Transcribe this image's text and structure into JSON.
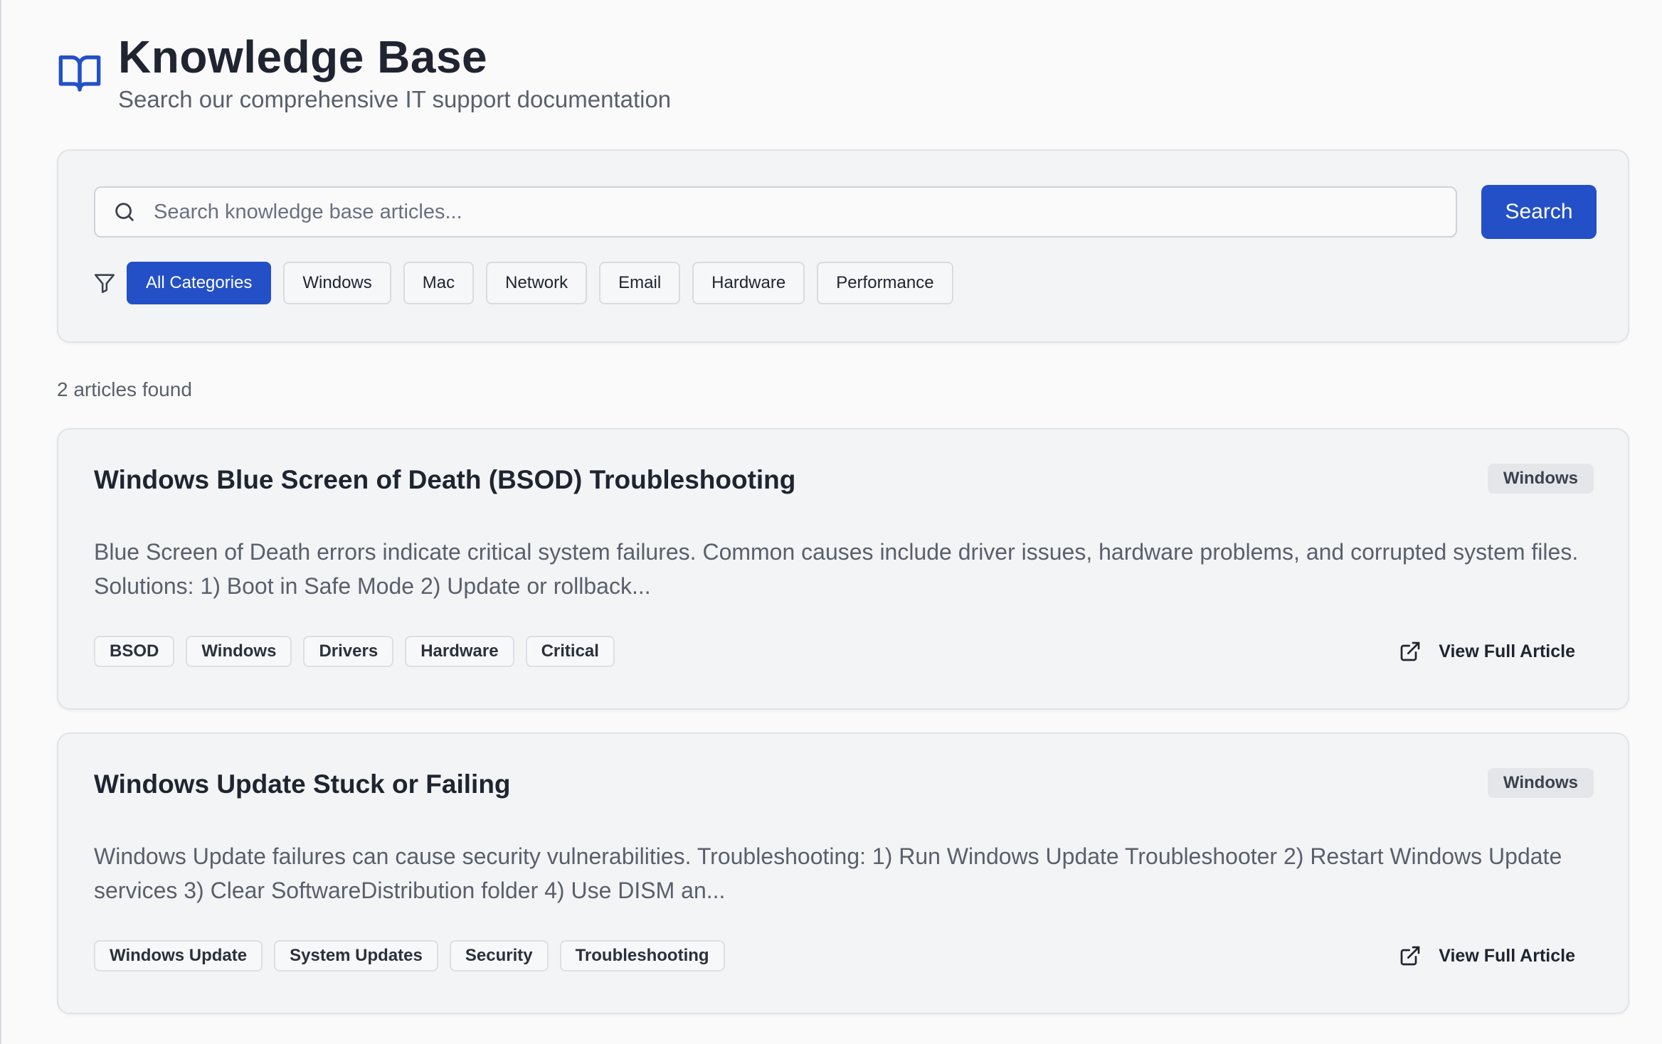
{
  "header": {
    "title": "Knowledge Base",
    "subtitle": "Search our comprehensive IT support documentation"
  },
  "search": {
    "placeholder": "Search knowledge base articles...",
    "button_label": "Search"
  },
  "filters": {
    "categories": [
      "All Categories",
      "Windows",
      "Mac",
      "Network",
      "Email",
      "Hardware",
      "Performance"
    ],
    "active": "All Categories"
  },
  "results": {
    "count_text": "2 articles found",
    "articles": [
      {
        "title": "Windows Blue Screen of Death (BSOD) Troubleshooting",
        "category": "Windows",
        "description": "Blue Screen of Death errors indicate critical system failures. Common causes include driver issues, hardware problems, and corrupted system files. Solutions: 1) Boot in Safe Mode 2) Update or rollback...",
        "tags": [
          "BSOD",
          "Windows",
          "Drivers",
          "Hardware",
          "Critical"
        ],
        "link_label": "View Full Article"
      },
      {
        "title": "Windows Update Stuck or Failing",
        "category": "Windows",
        "description": "Windows Update failures can cause security vulnerabilities. Troubleshooting: 1) Run Windows Update Troubleshooter 2) Restart Windows Update services 3) Clear SoftwareDistribution folder 4) Use DISM an...",
        "tags": [
          "Windows Update",
          "System Updates",
          "Security",
          "Troubleshooting"
        ],
        "link_label": "View Full Article"
      }
    ]
  },
  "colors": {
    "accent": "#2350c7",
    "background": "#fafafb",
    "card": "#f3f4f6"
  },
  "icons": {
    "header": "book-open-icon",
    "search": "search-icon",
    "filter": "filter-icon",
    "link": "external-link-icon"
  }
}
